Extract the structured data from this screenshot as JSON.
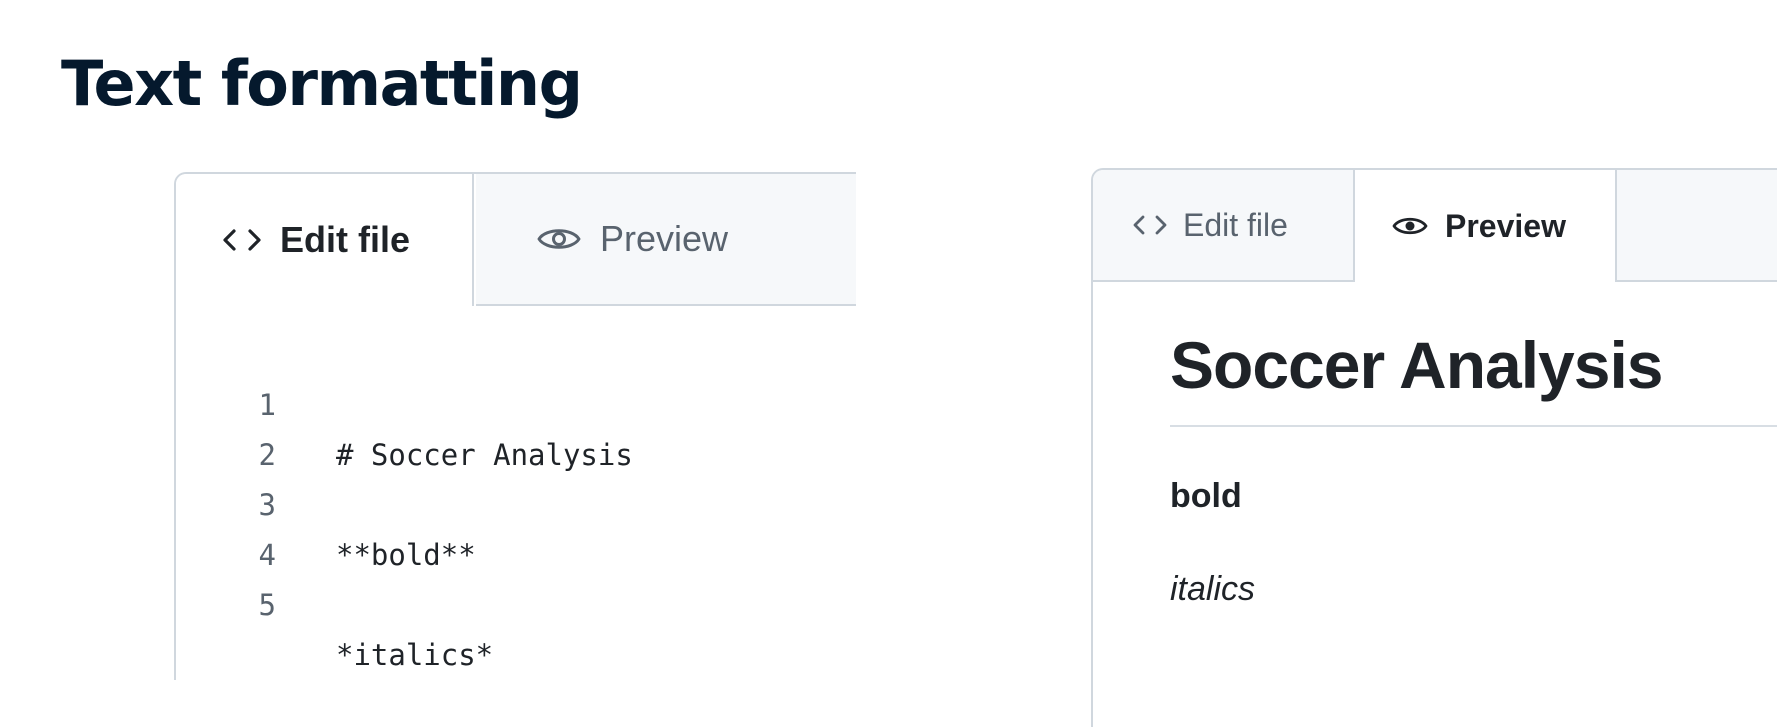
{
  "page": {
    "title": "Text formatting"
  },
  "editor_panel": {
    "tabs": {
      "edit_label": "Edit file",
      "preview_label": "Preview",
      "active": "edit"
    },
    "code_lines": [
      {
        "number": "1",
        "text": "# Soccer Analysis"
      },
      {
        "number": "2",
        "text": ""
      },
      {
        "number": "3",
        "text": "**bold**"
      },
      {
        "number": "4",
        "text": ""
      },
      {
        "number": "5",
        "text": "*italics*"
      }
    ]
  },
  "preview_panel": {
    "tabs": {
      "edit_label": "Edit file",
      "preview_label": "Preview",
      "active": "preview"
    },
    "rendered": {
      "heading": "Soccer Analysis",
      "bold_text": "bold",
      "italic_text": "italics"
    }
  },
  "icons": {
    "edit_tab_icon": "code-brackets-icon",
    "preview_tab_icon": "eye-icon"
  },
  "colors": {
    "title_navy": "#05192d",
    "text_primary": "#1f2328",
    "text_muted": "#59636e",
    "border": "#d0d7de",
    "tab_inactive_bg": "#f6f8fa"
  }
}
